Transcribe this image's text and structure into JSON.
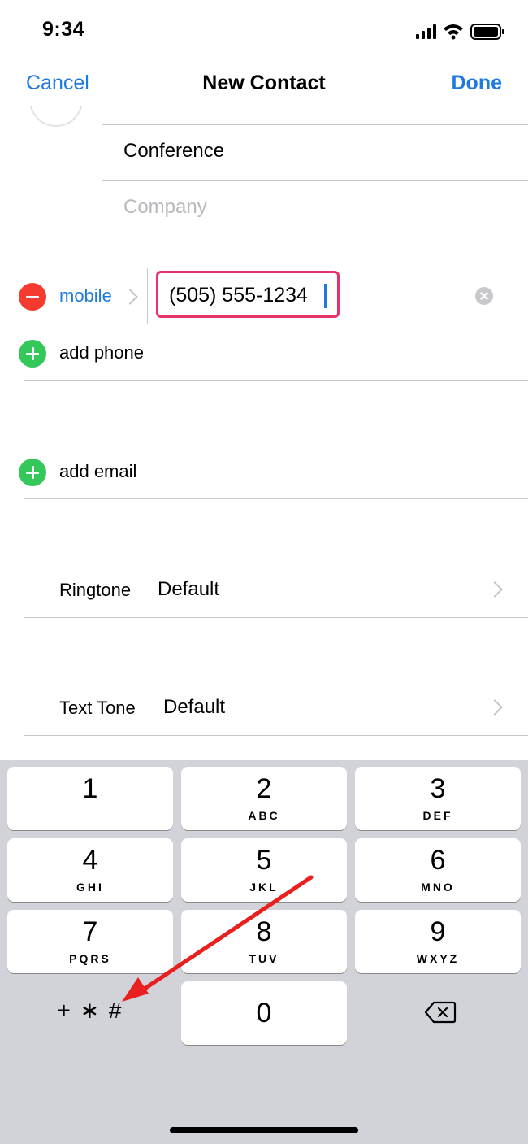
{
  "status_bar": {
    "time": "9:34",
    "icons": [
      "signal-icon",
      "wifi-icon",
      "battery-icon"
    ]
  },
  "nav": {
    "cancel": "Cancel",
    "title": "New Contact",
    "done": "Done"
  },
  "fields": {
    "name_value": "Conference",
    "company_placeholder": "Company"
  },
  "phone": {
    "label": "mobile",
    "value": "(505) 555-1234",
    "add_phone": "add phone"
  },
  "email": {
    "add_email": "add email"
  },
  "ringtone": {
    "label": "Ringtone",
    "value": "Default"
  },
  "text_tone": {
    "label": "Text Tone",
    "value": "Default"
  },
  "keypad": {
    "keys": [
      {
        "num": "1",
        "letters": ""
      },
      {
        "num": "2",
        "letters": "ABC"
      },
      {
        "num": "3",
        "letters": "DEF"
      },
      {
        "num": "4",
        "letters": "GHI"
      },
      {
        "num": "5",
        "letters": "JKL"
      },
      {
        "num": "6",
        "letters": "MNO"
      },
      {
        "num": "7",
        "letters": "PQRS"
      },
      {
        "num": "8",
        "letters": "TUV"
      },
      {
        "num": "9",
        "letters": "WXYZ"
      },
      {
        "num": "0",
        "letters": ""
      }
    ],
    "symbols_key": "+ ∗ #"
  },
  "colors": {
    "accent": "#1f7ae0",
    "delete": "#f53b30",
    "add": "#34c759",
    "highlight": "#e8336a",
    "arrow": "#e8201f"
  }
}
